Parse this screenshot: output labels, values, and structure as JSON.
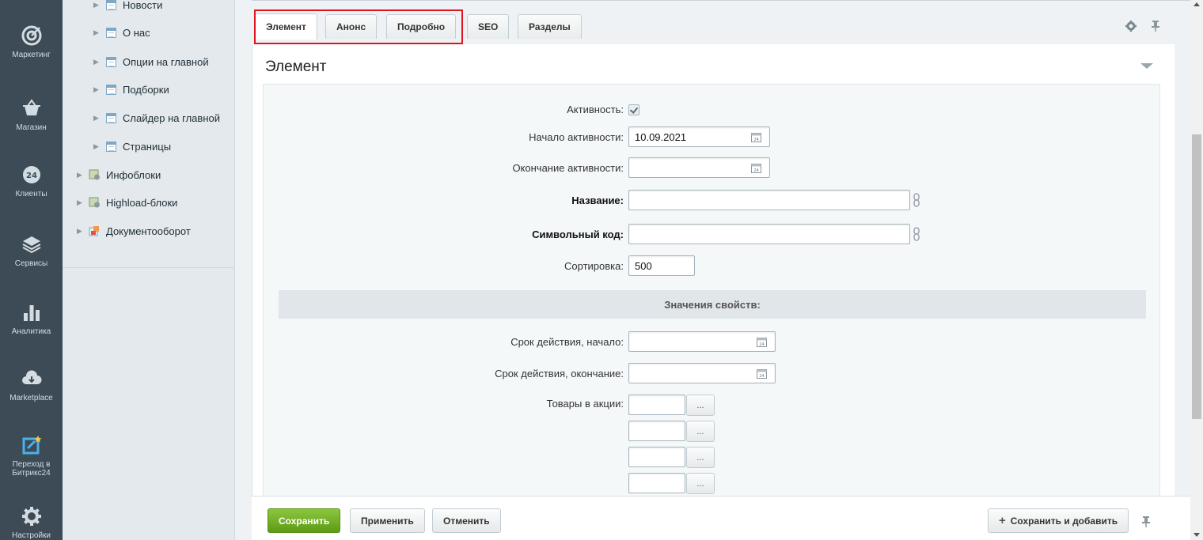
{
  "leftnav": [
    {
      "label": "Маркетинг",
      "icon": "target-icon"
    },
    {
      "label": "Магазин",
      "icon": "basket-icon"
    },
    {
      "label": "Клиенты",
      "icon": "clients-24-icon"
    },
    {
      "label": "Сервисы",
      "icon": "layers-icon"
    },
    {
      "label": "Аналитика",
      "icon": "bar-chart-icon"
    },
    {
      "label": "Marketplace",
      "icon": "cloud-download-icon"
    },
    {
      "label": "Переход в Битрикс24",
      "icon": "bitrix24-icon"
    },
    {
      "label": "Настройки",
      "icon": "gear-icon"
    }
  ],
  "tree": {
    "items": [
      {
        "label": "Новости"
      },
      {
        "label": "О нас"
      },
      {
        "label": "Опции на главной"
      },
      {
        "label": "Подборки"
      },
      {
        "label": "Слайдер на главной"
      },
      {
        "label": "Страницы"
      },
      {
        "label": "Инфоблоки"
      },
      {
        "label": "Highload-блоки"
      },
      {
        "label": "Документооборот"
      }
    ]
  },
  "tabs": [
    {
      "label": "Элемент",
      "active": true
    },
    {
      "label": "Анонс",
      "active": false
    },
    {
      "label": "Подробно",
      "active": false
    },
    {
      "label": "SEO",
      "active": false
    },
    {
      "label": "Разделы",
      "active": false
    }
  ],
  "section": {
    "title": "Элемент"
  },
  "form": {
    "active_label": "Активность:",
    "active_checked": true,
    "start_label": "Начало активности:",
    "start_value": "10.09.2021",
    "end_label": "Окончание активности:",
    "end_value": "",
    "name_label": "Название:",
    "name_value": "",
    "code_label": "Символьный код:",
    "code_value": "",
    "sort_label": "Сортировка:",
    "sort_value": "500",
    "props_header": "Значения свойств:",
    "valid_from_label": "Срок действия, начало:",
    "valid_from_value": "",
    "valid_to_label": "Срок действия, окончание:",
    "valid_to_value": "",
    "products_label": "Товары в акции:",
    "products_values": [
      "",
      "",
      "",
      ""
    ],
    "dots_label": "..."
  },
  "footer": {
    "save": "Сохранить",
    "apply": "Применить",
    "cancel": "Отменить",
    "save_add": "Сохранить и добавить"
  },
  "colors": {
    "nav_bg": "#3c4b56",
    "tree_bg": "#e3e9ed",
    "save_green": "#6cae1f",
    "highlight_red": "#e0141e"
  }
}
